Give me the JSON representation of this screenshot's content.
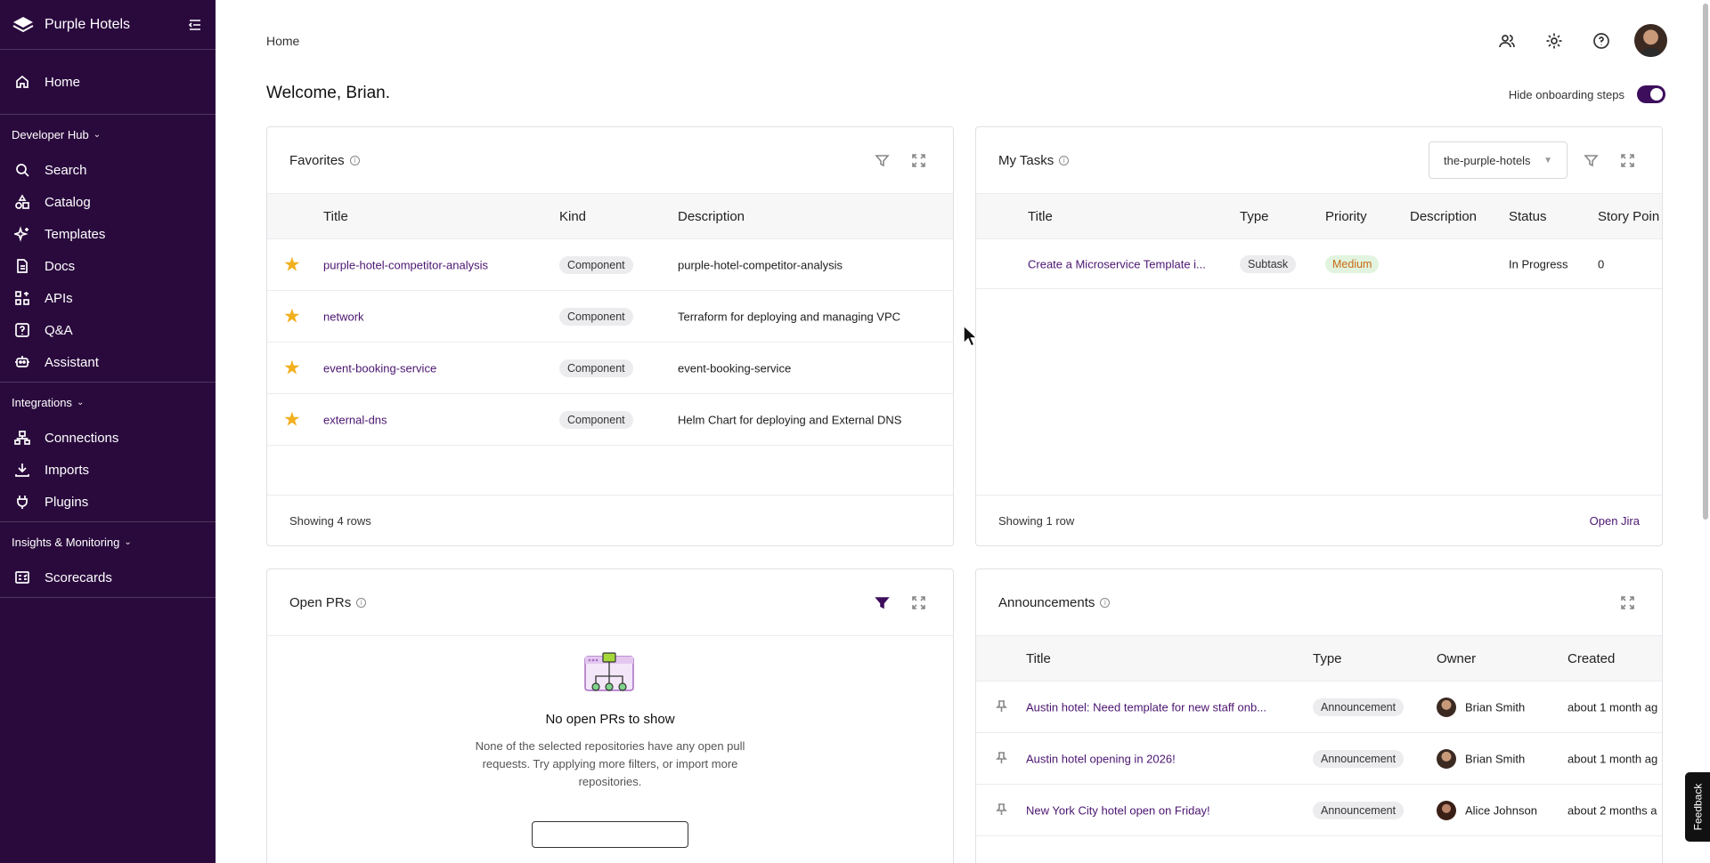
{
  "sidebar": {
    "brand": "Purple Hotels",
    "home": "Home",
    "sections": [
      {
        "label": "Developer Hub",
        "items": [
          "Search",
          "Catalog",
          "Templates",
          "Docs",
          "APIs",
          "Q&A",
          "Assistant"
        ]
      },
      {
        "label": "Integrations",
        "items": [
          "Connections",
          "Imports",
          "Plugins"
        ]
      },
      {
        "label": "Insights & Monitoring",
        "items": [
          "Scorecards"
        ]
      }
    ]
  },
  "header": {
    "breadcrumb": "Home",
    "welcome": "Welcome, Brian.",
    "hide_onboarding": "Hide onboarding steps"
  },
  "favorites": {
    "title": "Favorites",
    "columns": [
      "Title",
      "Kind",
      "Description"
    ],
    "rows": [
      {
        "title": "purple-hotel-competitor-analysis",
        "kind": "Component",
        "description": "purple-hotel-competitor-analysis"
      },
      {
        "title": "network",
        "kind": "Component",
        "description": "Terraform for deploying and managing VPC"
      },
      {
        "title": "event-booking-service",
        "kind": "Component",
        "description": "event-booking-service"
      },
      {
        "title": "external-dns",
        "kind": "Component",
        "description": "Helm Chart for deploying and External DNS"
      }
    ],
    "footer": "Showing 4 rows"
  },
  "tasks": {
    "title": "My Tasks",
    "project": "the-purple-hotels",
    "columns": [
      "Title",
      "Type",
      "Priority",
      "Description",
      "Status",
      "Story Poin"
    ],
    "rows": [
      {
        "title": "Create a Microservice Template i...",
        "type": "Subtask",
        "priority": "Medium",
        "description": "",
        "status": "In Progress",
        "points": "0"
      }
    ],
    "footer": "Showing 1 row",
    "open_jira": "Open Jira"
  },
  "prs": {
    "title": "Open PRs",
    "empty_title": "No open PRs to show",
    "empty_text": "None of the selected repositories have any open pull requests. Try applying more filters, or import more repositories."
  },
  "announcements": {
    "title": "Announcements",
    "columns": [
      "Title",
      "Type",
      "Owner",
      "Created"
    ],
    "rows": [
      {
        "title": "Austin hotel: Need template for new staff onb...",
        "type": "Announcement",
        "owner": "Brian Smith",
        "created": "about 1 month ag"
      },
      {
        "title": "Austin hotel opening in 2026!",
        "type": "Announcement",
        "owner": "Brian Smith",
        "created": "about 1 month ag"
      },
      {
        "title": "New York City hotel open on Friday!",
        "type": "Announcement",
        "owner": "Alice Johnson",
        "created": "about 2 months a"
      }
    ]
  },
  "feedback": "Feedback",
  "colors": {
    "sidebar_bg": "#2a0a3d",
    "accent": "#4b1570",
    "star": "#f2b01e"
  }
}
